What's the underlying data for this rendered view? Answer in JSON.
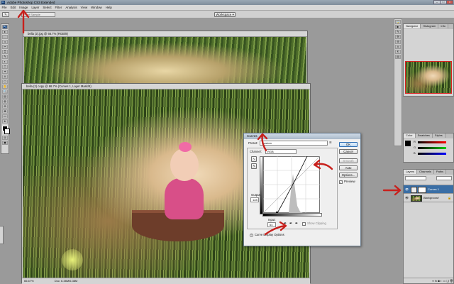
{
  "window": {
    "title": "Adobe Photoshop CS3 Extended",
    "ps_logo": "Ps"
  },
  "menu": [
    "File",
    "Edit",
    "Image",
    "Layer",
    "Select",
    "Filter",
    "Analysis",
    "View",
    "Window",
    "Help"
  ],
  "options_bar": {
    "sample_label": "Point Sample",
    "workspace_label": "Workspace ▾"
  },
  "tools": [
    "▸",
    "⬚",
    "ↄ",
    "✂",
    "⌗",
    "✎",
    "◐",
    "⎍",
    "✦",
    "A",
    "⬡",
    "✋",
    "🔍"
  ],
  "documents": {
    "back": {
      "title": "bella (2).jpg @ 66.7% (RGB/8)"
    },
    "front": {
      "title": "bella (2) copy @ 66.7% (Curves 1, Layer Mask/8)",
      "zoom": "66.67%",
      "doc_size": "Doc: 6.38M/6.38M"
    }
  },
  "navigator": {
    "tabs": [
      "Navigator",
      "Histogram",
      "Info"
    ]
  },
  "color_panel": {
    "tabs": [
      "Color",
      "Swatches",
      "Styles"
    ],
    "sliders": [
      "R",
      "G",
      "B"
    ]
  },
  "layers_panel": {
    "tabs": [
      "Layers",
      "Channels",
      "Paths"
    ],
    "rows": [
      {
        "name": "Curves 1"
      },
      {
        "name": "Background"
      }
    ]
  },
  "curves_dialog": {
    "title": "Curves",
    "preset_label": "Preset:",
    "preset_value": "Custom",
    "channel_label": "Channel:",
    "channel_value": "RGB",
    "output_label": "Output:",
    "output_value": "128",
    "input_label": "Input:",
    "input_value": "64",
    "show_clipping": "Show Clipping",
    "preview_label": "Preview",
    "display_options": "Curve Display Options",
    "buttons": [
      "OK",
      "Cancel",
      "Smooth",
      "Auto",
      "Options..."
    ]
  },
  "colors": {
    "arrow": "#c8201c",
    "accent": "#1f4f86"
  }
}
